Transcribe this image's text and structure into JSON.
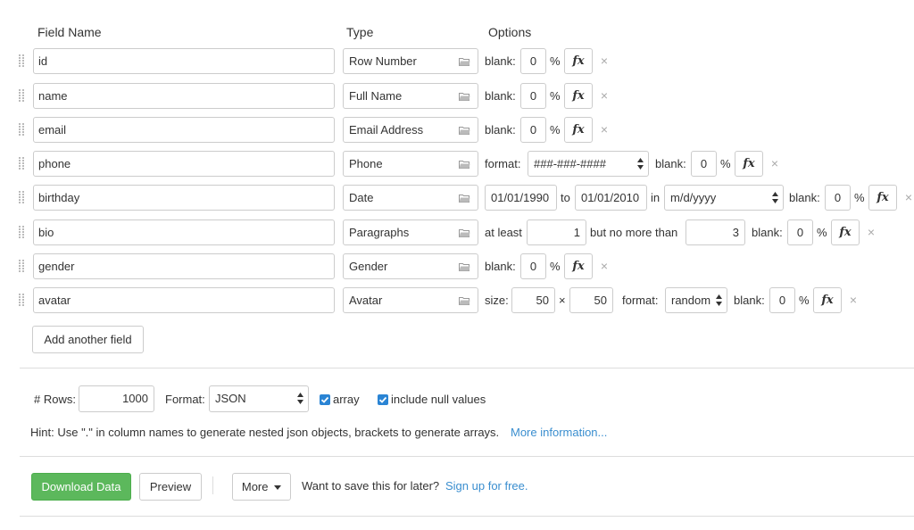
{
  "headers": {
    "field_name": "Field Name",
    "type": "Type",
    "options": "Options"
  },
  "fields": [
    {
      "name": "id",
      "type": "Row Number",
      "blank": "0"
    },
    {
      "name": "name",
      "type": "Full Name",
      "blank": "0"
    },
    {
      "name": "email",
      "type": "Email Address",
      "blank": "0"
    },
    {
      "name": "phone",
      "type": "Phone",
      "blank": "0",
      "format_label": "format:",
      "format": "###-###-####"
    },
    {
      "name": "birthday",
      "type": "Date",
      "blank": "0",
      "from": "01/01/1990",
      "to_label": "to",
      "to": "01/01/2010",
      "in_label": "in",
      "format": "m/d/yyyy"
    },
    {
      "name": "bio",
      "type": "Paragraphs",
      "blank": "0",
      "at_least_label": "at least",
      "min": "1",
      "no_more_label": "but no more than",
      "max": "3"
    },
    {
      "name": "gender",
      "type": "Gender",
      "blank": "0"
    },
    {
      "name": "avatar",
      "type": "Avatar",
      "blank": "0",
      "size_label": "size:",
      "width": "50",
      "times": "×",
      "height": "50",
      "format_label": "format:",
      "format": "random"
    }
  ],
  "labels": {
    "blank": "blank:",
    "percent": "%",
    "fx": "fx",
    "remove": "×"
  },
  "add_field_label": "Add another field",
  "settings": {
    "rows_label": "# Rows:",
    "rows": "1000",
    "format_label": "Format:",
    "format": "JSON",
    "array_label": "array",
    "array_checked": true,
    "null_label": "include null values",
    "null_checked": true
  },
  "hint": {
    "text": "Hint: Use \".\" in column names to generate nested json objects, brackets to generate arrays.",
    "link": "More information..."
  },
  "actions": {
    "download": "Download Data",
    "preview": "Preview",
    "more": "More",
    "save_prompt": "Want to save this for later?",
    "signup": "Sign up for free."
  },
  "colors": {
    "accent_green": "#5cb85c",
    "link_blue": "#3a8ecf",
    "checkbox_blue": "#2a84d4"
  }
}
